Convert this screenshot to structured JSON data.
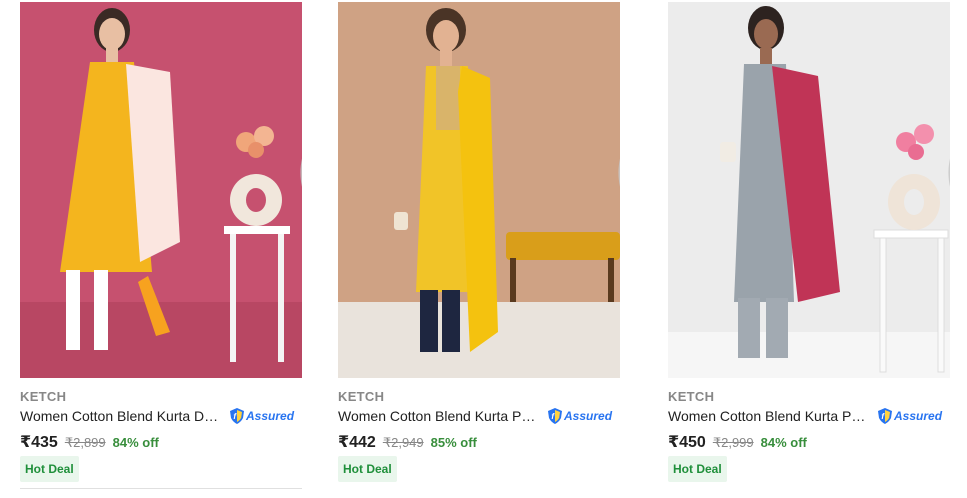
{
  "products": [
    {
      "brand": "KETCH",
      "title": "Women Cotton Blend Kurta Dup...",
      "assured_label": "Assured",
      "price": "₹435",
      "mrp": "₹2,899",
      "discount": "84% off",
      "badge": "Hot Deal",
      "wishlist_icon": "heart-icon"
    },
    {
      "brand": "KETCH",
      "title": "Women Cotton Blend Kurta Pala...",
      "assured_label": "Assured",
      "price": "₹442",
      "mrp": "₹2,949",
      "discount": "85% off",
      "badge": "Hot Deal",
      "wishlist_icon": "heart-icon"
    },
    {
      "brand": "KETCH",
      "title": "Women Cotton Blend Kurta Pala...",
      "assured_label": "Assured",
      "price": "₹450",
      "mrp": "₹2,999",
      "discount": "84% off",
      "badge": "Hot Deal",
      "wishlist_icon": "heart-icon"
    }
  ],
  "colors": {
    "discount_green": "#388e3c",
    "assured_blue": "#2874f0",
    "badge_bg": "#e9f6ec",
    "muted_text": "#878787"
  }
}
